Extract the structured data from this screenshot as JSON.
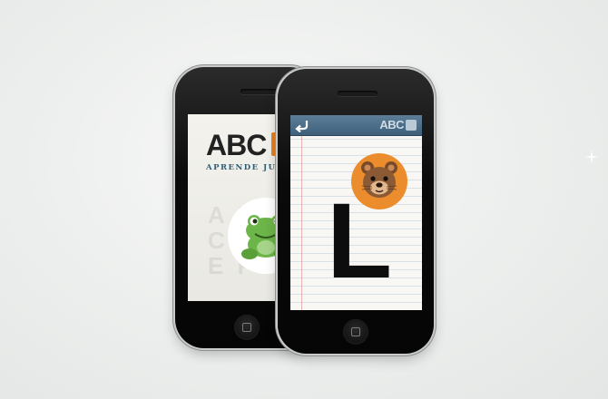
{
  "colors": {
    "background": "#eceeed",
    "phone_body": "#0a0a0a",
    "title_bar": "#4a6b85",
    "brand_tile": "#e9801f",
    "bear_circle": "#eb8d2c",
    "frog_green": "#6cb548",
    "tagline": "#2e5e76"
  },
  "decor": {
    "sparkle_icon": "sparkle-icon"
  },
  "phone_back": {
    "brand_title": "ABC",
    "tagline": "APRENDE JUGAN",
    "ghost_letters": [
      "A  B",
      "C   D",
      "E   F"
    ],
    "character_icon": "frog-icon",
    "home_icon": "home-button-icon"
  },
  "phone_front": {
    "nav_bar": {
      "back_icon": "back-arrow-icon",
      "title": "ABC"
    },
    "animal_icon": "bear-icon",
    "letter": "L",
    "home_icon": "home-button-icon"
  }
}
